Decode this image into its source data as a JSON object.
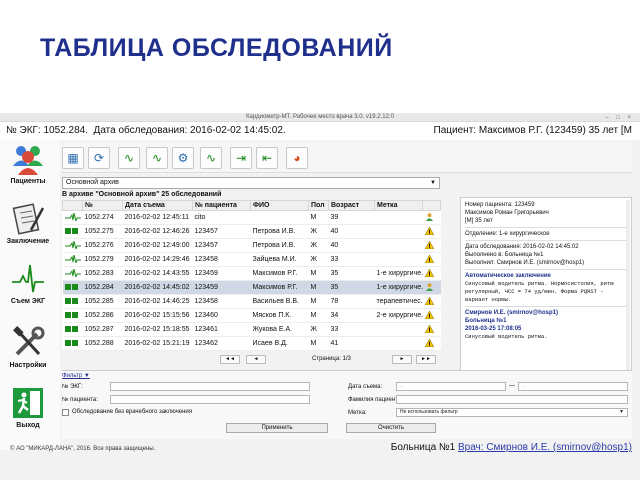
{
  "slide_title": "ТАБЛИЦА ОБСЛЕДОВАНИЙ",
  "window": {
    "title": "Кардиометр-МТ. Рабочее место врача 3.0. v19.2.12.0",
    "controls": "– □ ×"
  },
  "patient_bar": {
    "ecg_number": "№ ЭКГ: 1052.284.",
    "exam_date": "Дата обследования: 2016-02-02 14:45:02.",
    "patient": "Пациент: Максимов Р.Г. (123459)",
    "age_sex": "35 лет [М"
  },
  "sidebar": {
    "items": [
      {
        "label": "Пациенты",
        "icon": "patients-icon"
      },
      {
        "label": "Заключение",
        "icon": "notepad-icon"
      },
      {
        "label": "Съем ЭКГ",
        "icon": "ecg-wave-icon"
      },
      {
        "label": "Настройки",
        "icon": "tools-icon"
      },
      {
        "label": "Выход",
        "icon": "exit-icon"
      }
    ]
  },
  "archive_select": {
    "value": "Основной архив"
  },
  "archive_count": "В архиве \"Основной архив\" 25 обследований",
  "table": {
    "headers": [
      "",
      "№",
      "Дата съема",
      "№ пациента",
      "ФИО",
      "Пол",
      "Возраст",
      "Метка",
      ""
    ],
    "rows": [
      {
        "num": "1052.274",
        "date": "2016-02-02 12:45:11",
        "pnum": "cito",
        "name": "",
        "sex": "М",
        "age": "39",
        "mark": "",
        "status": "user"
      },
      {
        "num": "1052.275",
        "date": "2016-02-02 12:46:26",
        "pnum": "123457",
        "name": "Петрова И.В.",
        "sex": "Ж",
        "age": "40",
        "mark": "",
        "status": "warn"
      },
      {
        "num": "1052.276",
        "date": "2016-02-02 12:49:00",
        "pnum": "123457",
        "name": "Петрова И.В.",
        "sex": "Ж",
        "age": "40",
        "mark": "",
        "status": "warn"
      },
      {
        "num": "1052.279",
        "date": "2016-02-02 14:29:46",
        "pnum": "123458",
        "name": "Зайцева М.И.",
        "sex": "Ж",
        "age": "33",
        "mark": "",
        "status": "warn"
      },
      {
        "num": "1052.283",
        "date": "2016-02-02 14:43:55",
        "pnum": "123459",
        "name": "Максимов Р.Г.",
        "sex": "М",
        "age": "35",
        "mark": "1-е хирургиче...",
        "status": "warn"
      },
      {
        "num": "1052.284",
        "date": "2016-02-02 14:45:02",
        "pnum": "123459",
        "name": "Максимов Р.Г.",
        "sex": "М",
        "age": "35",
        "mark": "1-е хирургиче...",
        "status": "user"
      },
      {
        "num": "1052.285",
        "date": "2016-02-02 14:46:25",
        "pnum": "123458",
        "name": "Васильев В.В.",
        "sex": "М",
        "age": "78",
        "mark": "терапевтичес...",
        "status": "warn"
      },
      {
        "num": "1052.286",
        "date": "2016-02-02 15:15:56",
        "pnum": "123460",
        "name": "Мясков П.К.",
        "sex": "М",
        "age": "34",
        "mark": "2-е хирургиче...",
        "status": "warn"
      },
      {
        "num": "1052.287",
        "date": "2016-02-02 15:18:55",
        "pnum": "123461",
        "name": "Жукова Е.А.",
        "sex": "Ж",
        "age": "33",
        "mark": "",
        "status": "warn"
      },
      {
        "num": "1052.288",
        "date": "2016-02-02 15:21:19",
        "pnum": "123462",
        "name": "Исаев В.Д.",
        "sex": "М",
        "age": "41",
        "mark": "",
        "status": "warn"
      }
    ],
    "selected_row": 5
  },
  "pager": {
    "label": "Страница: 1/3",
    "first": "◄◄",
    "prev": "◄",
    "next": "►",
    "last": "►►"
  },
  "detail": {
    "patient_no": "Номер пациента: 123459",
    "patient_name": "Максимов Роман Григорьевич",
    "patient_age": "[М] 35 лет",
    "department": "Отделение: 1-е хирургическое",
    "exam_date": "Дата обследования: 2016-02-02 14:45:02",
    "performed_in": "Выполнено в: Больница №1",
    "performed_by": "Выполнил: Смирнов И.Е. (smirnov@hosp1)",
    "auto_title": "Автоматическое заключение",
    "auto_text": "Синусовый водитель ритма. Нормосистолия, ритм регулярный, ЧСС = 74 уд/мин. Форма PQRST - вариант нормы.",
    "doctor": "Смирнов И.Е. (smirnov@hosp1)",
    "hospital": "Больница №1",
    "date": "2016-03-25 17:08:05",
    "doctor_text": "Синусовый водитель ритма."
  },
  "filter": {
    "title": "Фильтр ▼",
    "ecg_label": "№ ЭКГ:",
    "patient_label": "№ пациента:",
    "no_conclusion_label": "Обследование без врачебного заключения",
    "date_label": "Дата съема:",
    "date_from": ". .",
    "date_to": ". .",
    "name_label": "Фамилия пациента:",
    "mark_label": "Метка:",
    "mark_value": "Не использовать фильтр",
    "apply": "Применить",
    "clear": "Очистить"
  },
  "copyright": "© АО \"МИКАРД-ЛАНА\", 2016. Все права защищены.",
  "status_line": {
    "hospital": "Больница №1",
    "doctor": "Врач: Смирнов И.Е. (smirnov@hosp1)"
  },
  "colors": {
    "title": "#1f2f8c",
    "selected_row": "#cfd8e4",
    "ecg_green": "#1a8a1a",
    "warn_yellow": "#f2c200",
    "link": "#2a3aa8"
  }
}
